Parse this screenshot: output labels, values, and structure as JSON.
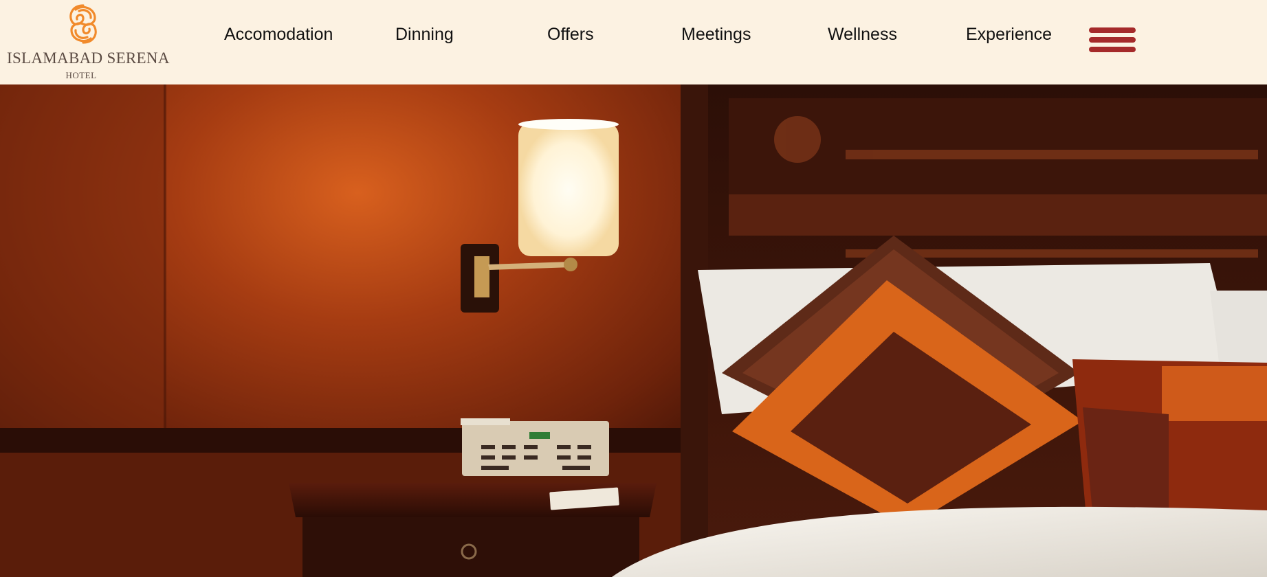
{
  "brand": {
    "name": "ISLAMABAD SERENA",
    "sub": "HOTEL",
    "logo_icon": "serena-fingerprint-logo",
    "accent_color": "#f18a2b",
    "text_color": "#5a4a42"
  },
  "nav": {
    "items": [
      "Accomodation",
      "Dinning",
      "Offers",
      "Meetings",
      "Wellness",
      "Experience"
    ]
  },
  "menu": {
    "icon": "hamburger-menu-icon",
    "color": "#a52a2a"
  },
  "hero": {
    "image": "hotel-room-bedside-lamp-and-cushions",
    "colors": {
      "wall": "#9e3a12",
      "lamp_glow": "#fff4dc",
      "cushion": "#d9651a",
      "headboard": "#3a140b",
      "linen": "#f1ece4"
    }
  }
}
